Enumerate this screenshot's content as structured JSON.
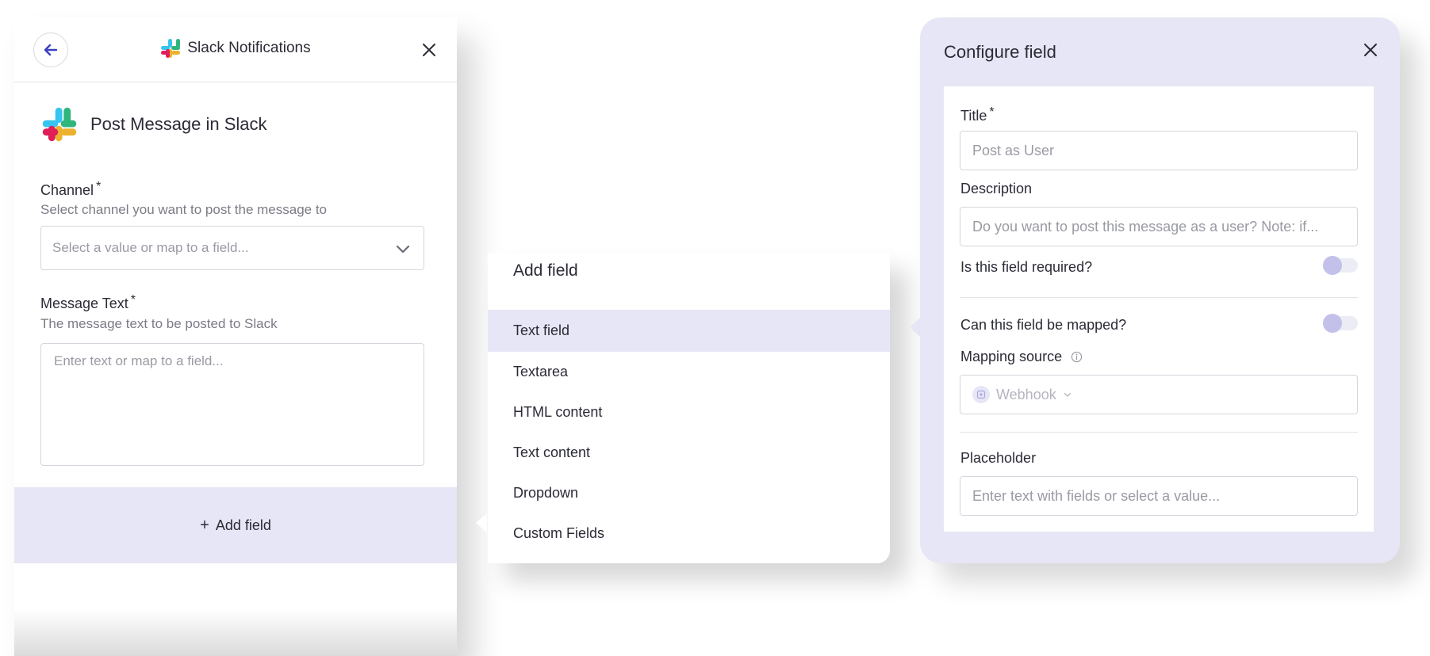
{
  "left_panel": {
    "header": {
      "title": "Slack Notifications"
    },
    "action": {
      "title": "Post Message in Slack"
    },
    "channel": {
      "label": "Channel",
      "required_mark": "*",
      "help": "Select channel you want to post the message to",
      "placeholder": "Select a value or map to a field..."
    },
    "message_text": {
      "label": "Message Text",
      "required_mark": "*",
      "help": "The message text to be posted to Slack",
      "placeholder": "Enter text or map to a field..."
    },
    "add_field": {
      "plus": "+",
      "label": "Add field"
    }
  },
  "add_field_menu": {
    "title": "Add field",
    "items": [
      {
        "label": "Text field",
        "active": true
      },
      {
        "label": "Textarea"
      },
      {
        "label": "HTML content"
      },
      {
        "label": "Text content"
      },
      {
        "label": "Dropdown"
      },
      {
        "label": "Custom Fields"
      }
    ]
  },
  "configure_field": {
    "title": "Configure field",
    "title_field": {
      "label": "Title",
      "required_mark": "*",
      "placeholder": "Post as User"
    },
    "description_field": {
      "label": "Description",
      "placeholder": "Do you want to post this message as a user? Note: if..."
    },
    "required_toggle": {
      "label": "Is this field required?",
      "on": false
    },
    "mapped_toggle": {
      "label": "Can this field be mapped?",
      "on": false
    },
    "mapping_source": {
      "label": "Mapping source",
      "value": "Webhook"
    },
    "placeholder_field": {
      "label": "Placeholder",
      "placeholder": "Enter text with fields or select a value..."
    }
  },
  "colors": {
    "accent": "#3b40c4",
    "highlight": "#e7e6f6",
    "toggle_knob": "#c3c1ea",
    "text": "#2b2b36",
    "muted": "#7b7b86",
    "placeholder": "#9a9aa4"
  },
  "icons": [
    "arrow-left-icon",
    "slack-logo-icon",
    "close-icon",
    "chevron-down-icon",
    "info-icon",
    "webhook-icon"
  ]
}
